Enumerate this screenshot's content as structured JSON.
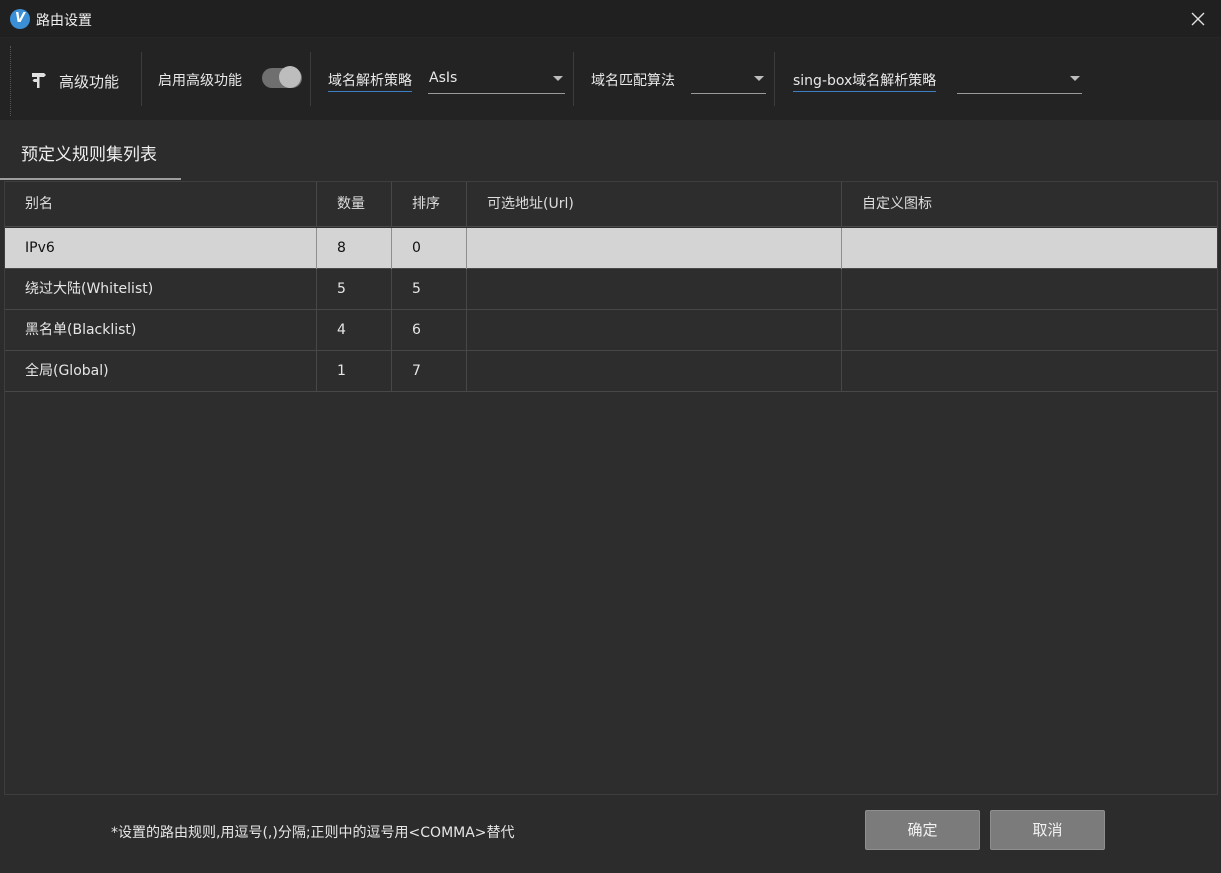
{
  "window": {
    "title": "路由设置",
    "logo_letter": "V"
  },
  "toolbar": {
    "advanced_label": "高级功能",
    "enable_advanced_label": "启用高级功能",
    "enable_advanced_on": true,
    "domain_strategy": {
      "label": "域名解析策略",
      "value": "AsIs"
    },
    "domain_matcher": {
      "label": "域名匹配算法",
      "value": ""
    },
    "singbox_strategy": {
      "label": "sing-box域名解析策略",
      "value": ""
    }
  },
  "tabs": [
    {
      "label": "预定义规则集列表",
      "selected": true
    }
  ],
  "table": {
    "columns": [
      "别名",
      "数量",
      "排序",
      "可选地址(Url)",
      "自定义图标"
    ],
    "rows": [
      {
        "alias": "IPv6",
        "count": "8",
        "order": "0",
        "url": "",
        "icon": "",
        "selected": true
      },
      {
        "alias": "绕过大陆(Whitelist)",
        "count": "5",
        "order": "5",
        "url": "",
        "icon": ""
      },
      {
        "alias": "黑名单(Blacklist)",
        "count": "4",
        "order": "6",
        "url": "",
        "icon": ""
      },
      {
        "alias": "全局(Global)",
        "count": "1",
        "order": "7",
        "url": "",
        "icon": ""
      }
    ]
  },
  "footer": {
    "note": "*设置的路由规则,用逗号(,)分隔;正则中的逗号用<COMMA>替代",
    "ok_label": "确定",
    "cancel_label": "取消"
  }
}
